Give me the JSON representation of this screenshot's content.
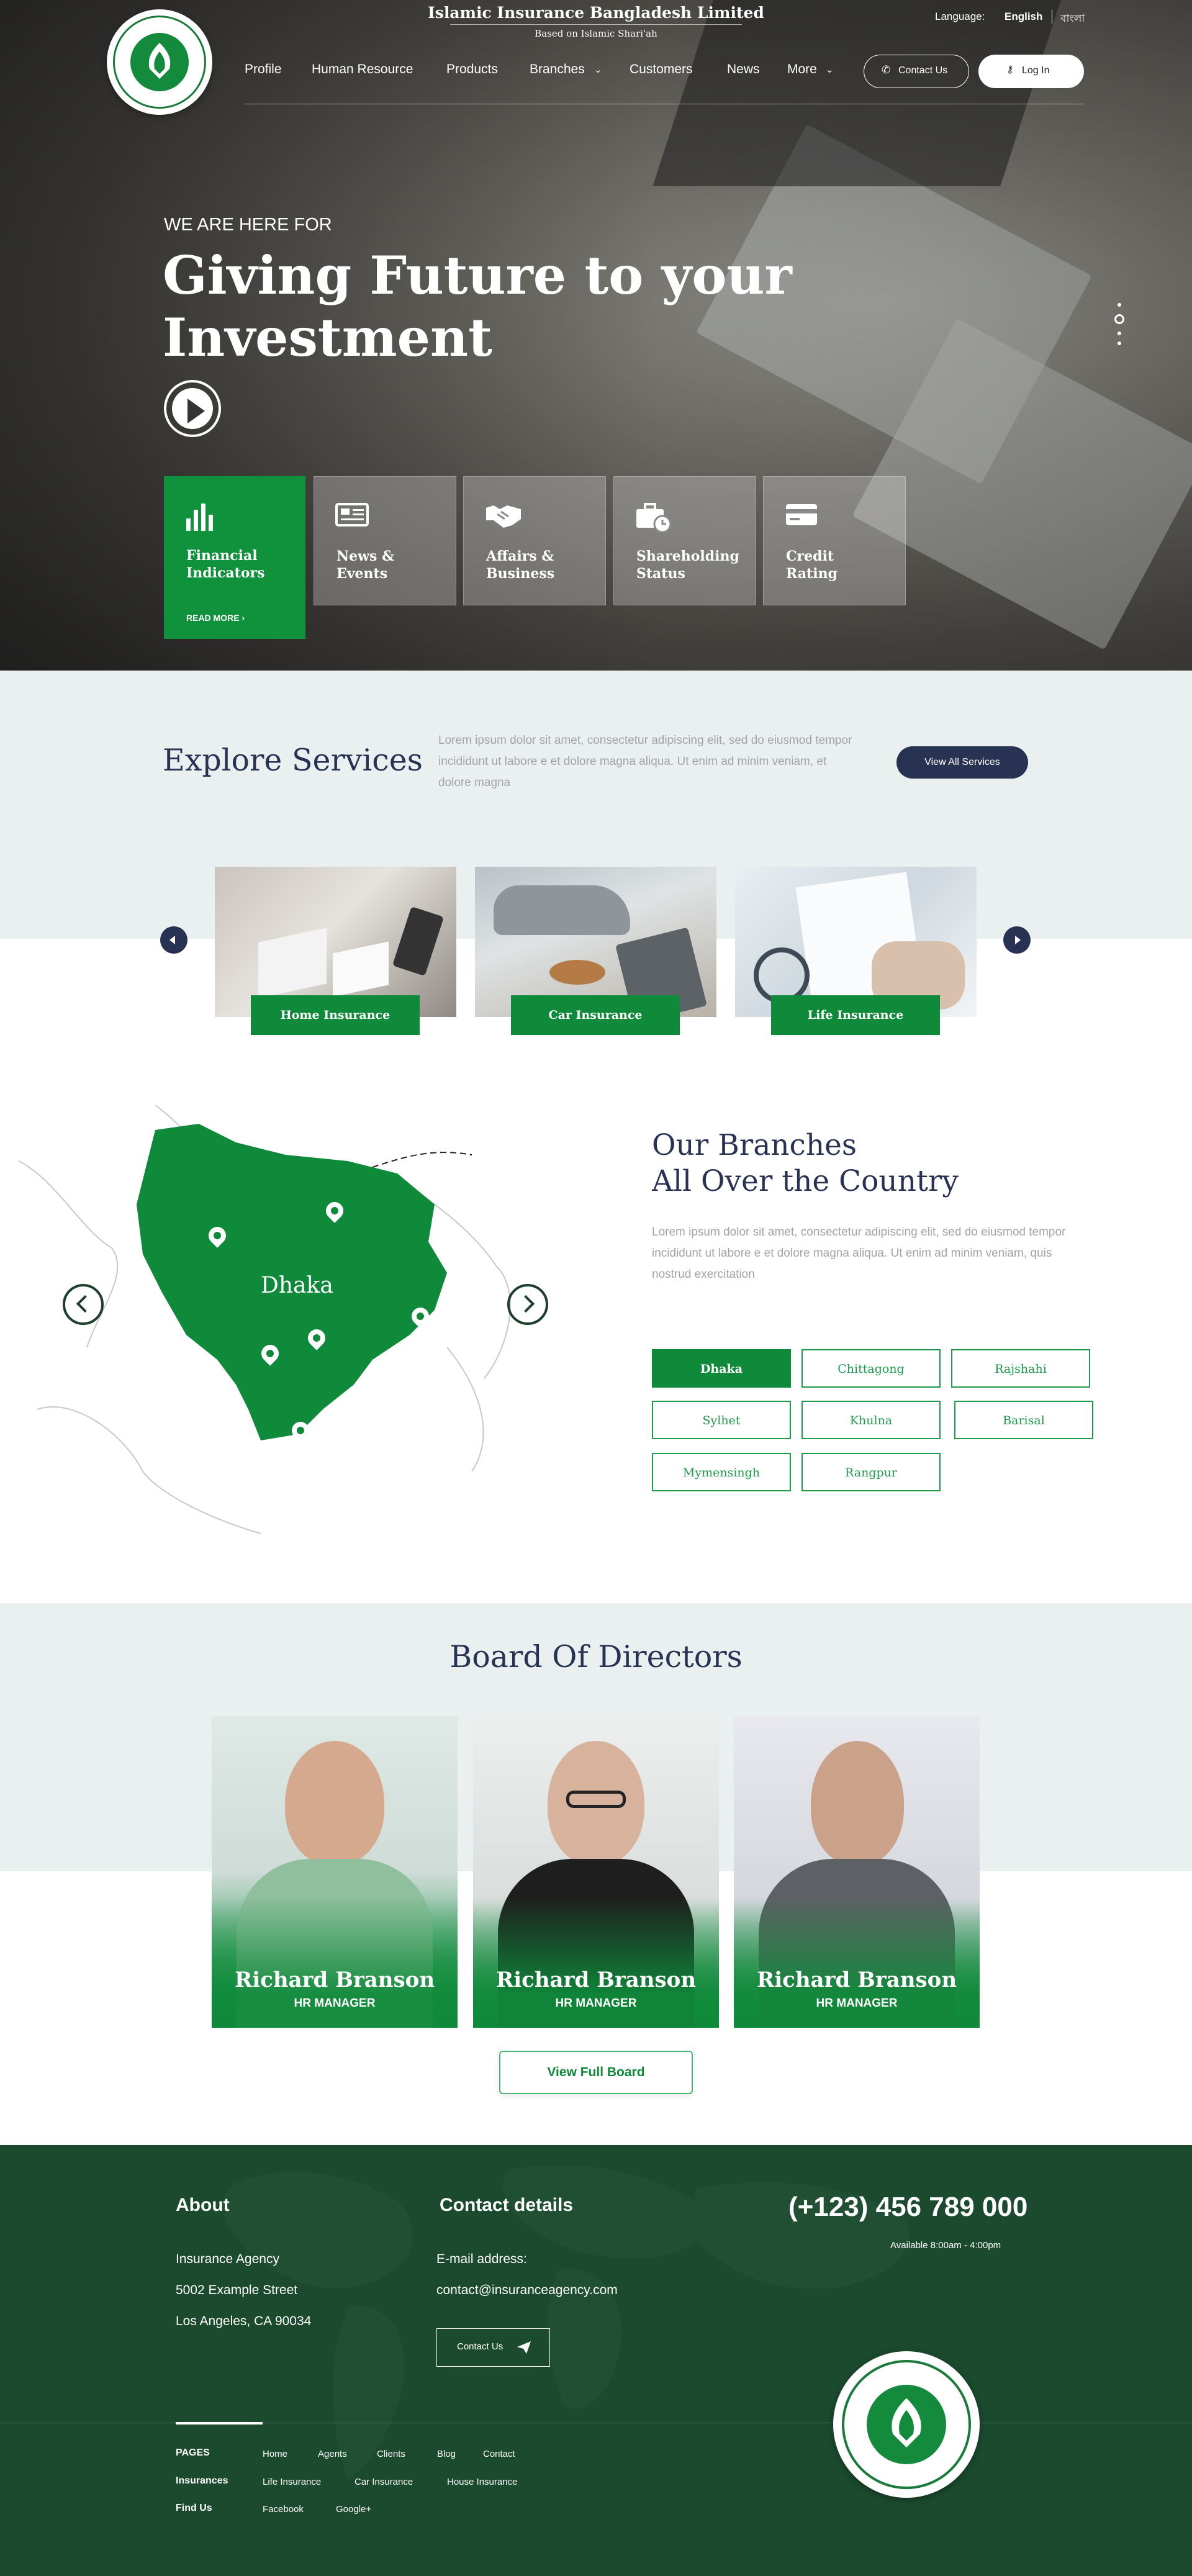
{
  "header": {
    "site_title": "Islamic Insurance Bangladesh Limited",
    "site_subtitle": "Based on Islamic Shari'ah",
    "language_label": "Language:",
    "language_options": [
      "English",
      "বাংলা"
    ],
    "nav": [
      "Profile",
      "Human Resource",
      "Products",
      "Branches",
      "Customers",
      "News",
      "More"
    ],
    "contact_button": "Contact Us",
    "login_button": "Log In"
  },
  "hero": {
    "eyebrow": "WE ARE HERE FOR",
    "headline_line1": "Giving Future to your",
    "headline_line2": "Investment",
    "tiles": [
      {
        "label_line1": "Financial",
        "label_line2": "Indicators",
        "link": "READ MORE ›",
        "icon": "bar-chart-icon"
      },
      {
        "label_line1": "News &",
        "label_line2": "Events",
        "icon": "newspaper-icon"
      },
      {
        "label_line1": "Affairs &",
        "label_line2": "Business",
        "icon": "handshake-icon"
      },
      {
        "label_line1": "Shareholding",
        "label_line2": "Status",
        "icon": "briefcase-clock-icon"
      },
      {
        "label_line1": "Credit",
        "label_line2": "Rating",
        "icon": "credit-card-icon"
      }
    ]
  },
  "services": {
    "title": "Explore Services",
    "description": "Lorem ipsum dolor sit amet, consectetur adipiscing elit, sed do eiusmod tempor incididunt ut labore e et dolore magna aliqua. Ut enim ad minim veniam, et dolore magna",
    "view_all": "View All Services",
    "cards": [
      "Home Insurance",
      "Car Insurance",
      "Life Insurance"
    ]
  },
  "branches": {
    "title_line1": "Our Branches",
    "title_line2": "All Over the Country",
    "description": "Lorem ipsum dolor sit amet, consectetur adipiscing elit, sed do eiusmod tempor incididunt ut labore e et dolore magna aliqua. Ut enim ad minim veniam, quis nostrud exercitation",
    "map_label": "Dhaka",
    "buttons": [
      "Dhaka",
      "Chittagong",
      "Rajshahi",
      "Sylhet",
      "Khulna",
      "Barisal",
      "Mymensingh",
      "Rangpur"
    ],
    "active": "Dhaka"
  },
  "directors": {
    "title": "Board Of Directors",
    "people": [
      {
        "name": "Richard Branson",
        "role": "HR MANAGER"
      },
      {
        "name": "Richard Branson",
        "role": "HR MANAGER"
      },
      {
        "name": "Richard Branson",
        "role": "HR MANAGER"
      }
    ],
    "view_full": "View Full Board"
  },
  "footer": {
    "about_title": "About",
    "about_lines": [
      "Insurance Agency",
      "5002 Example Street",
      "Los Angeles, CA 90034"
    ],
    "contact_title": "Contact details",
    "email_label": "E-mail address:",
    "email": "contact@insuranceagency.com",
    "contact_button": "Contact Us",
    "phone": "(+123) 456 789 000",
    "hours": "Available 8:00am - 4:00pm",
    "rows": [
      {
        "label": "PAGES",
        "links": [
          "Home",
          "Agents",
          "Clients",
          "Blog",
          "Contact"
        ]
      },
      {
        "label": "Insurances",
        "links": [
          "Life Insurance",
          "Car Insurance",
          "House Insurance"
        ]
      },
      {
        "label": "Find Us",
        "links": [
          "Facebook",
          "Google+"
        ]
      }
    ]
  },
  "colors": {
    "primary_green": "#0f8a3a",
    "navy": "#283354",
    "footer_green": "#1b4a2e",
    "light_bg": "#eaf0f0"
  }
}
